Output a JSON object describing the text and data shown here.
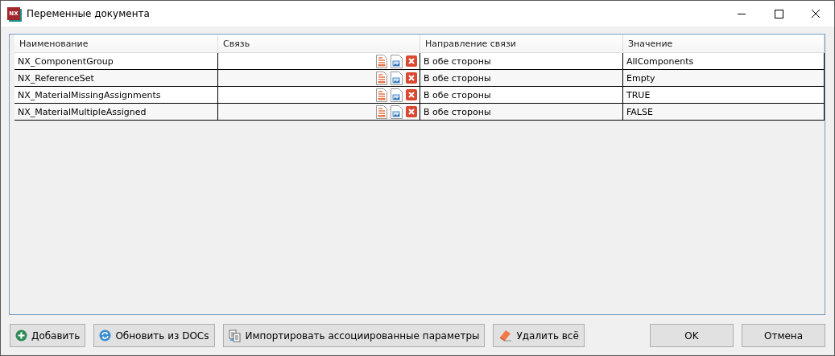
{
  "window": {
    "logo": "NX",
    "title": "Переменные документа"
  },
  "table": {
    "columns": [
      "Наименование",
      "Связь",
      "Направление связи",
      "Значение"
    ],
    "rows": [
      {
        "name": "NX_ComponentGroup",
        "direction": "В обе стороны",
        "value": "AllComponents"
      },
      {
        "name": "NX_ReferenceSet",
        "direction": "В обе стороны",
        "value": "Empty"
      },
      {
        "name": "NX_MaterialMissingAssignments",
        "direction": "В обе стороны",
        "value": "TRUE"
      },
      {
        "name": "NX_MaterialMultipleAssigned",
        "direction": "В обе стороны",
        "value": "FALSE"
      }
    ]
  },
  "left_buttons": [
    {
      "label": "Добавить",
      "kind": "add"
    },
    {
      "label": "Обновить из DOCs",
      "kind": "refresh"
    },
    {
      "label": "Импортировать ассоциированные параметры",
      "kind": "import"
    },
    {
      "label": "Удалить всё",
      "kind": "erase"
    }
  ],
  "right_buttons": [
    {
      "label": "OK"
    },
    {
      "label": "Отмена"
    }
  ]
}
